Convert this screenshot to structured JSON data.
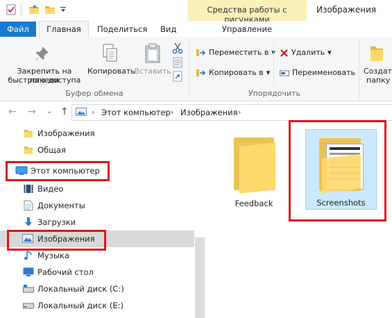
{
  "titlebar": {
    "tools_group": "Средства работы с рисунками",
    "window_title": "Изображения",
    "quick_access": [
      "qa-properties-icon",
      "qa-folder-icon",
      "qa-dropdown-icon"
    ]
  },
  "tabs": {
    "file": "Файл",
    "home": "Главная",
    "share": "Поделиться",
    "view": "Вид",
    "manage": "Управление"
  },
  "ribbon": {
    "pin_label_1": "Закрепить на панели",
    "pin_label_2": "быстрого доступа",
    "copy": "Копировать",
    "paste": "Вставить",
    "clipboard_group": "Буфер обмена",
    "move_to": "Переместить в",
    "copy_to": "Копировать в",
    "delete": "Удалить",
    "rename": "Переименовать",
    "organize_group": "Упорядочить",
    "create_1": "Создать",
    "create_2": "папку",
    "dropdown_arrow": "▾"
  },
  "address": {
    "crumbs": [
      "Этот компьютер",
      "Изображения"
    ],
    "separator": "›"
  },
  "nav": {
    "items": [
      {
        "label": "Изображения",
        "icon": "folder-icon"
      },
      {
        "label": "Общая",
        "icon": "folder-icon"
      },
      {
        "label": "Этот компьютер",
        "icon": "computer-icon"
      },
      {
        "label": "Видео",
        "icon": "video-icon"
      },
      {
        "label": "Документы",
        "icon": "document-icon"
      },
      {
        "label": "Загрузки",
        "icon": "download-icon"
      },
      {
        "label": "Изображения",
        "icon": "pictures-icon"
      },
      {
        "label": "Музыка",
        "icon": "music-icon"
      },
      {
        "label": "Рабочий стол",
        "icon": "desktop-icon"
      },
      {
        "label": "Локальный диск (C:)",
        "icon": "drive-icon"
      },
      {
        "label": "Локальный диск (E:)",
        "icon": "drive-icon"
      }
    ]
  },
  "content": {
    "files": [
      {
        "label": "Feedback",
        "icon": "folder-icon",
        "selected": false
      },
      {
        "label": "Screenshots",
        "icon": "folder-with-screenshots-icon",
        "selected": true
      }
    ]
  },
  "colors": {
    "file_tab": "#1979ca",
    "tools_highlight": "#fbf1b8",
    "selection": "#cce8ff",
    "annotation_red": "#d9161c"
  }
}
